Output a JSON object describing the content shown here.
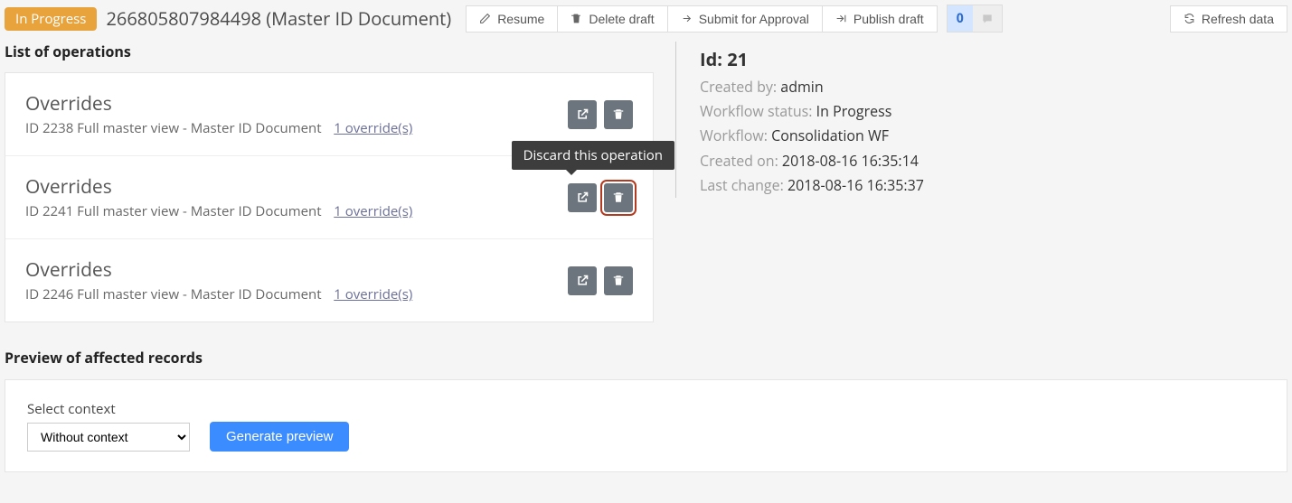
{
  "header": {
    "status_badge": "In Progress",
    "title": "266805807984498 (Master ID Document)",
    "toolbar": {
      "resume": "Resume",
      "delete_draft": "Delete draft",
      "submit_approval": "Submit for Approval",
      "publish_draft": "Publish draft",
      "refresh": "Refresh data"
    },
    "comments_count": "0"
  },
  "operations": {
    "heading": "List of operations",
    "tooltip_discard": "Discard this operation",
    "items": [
      {
        "title": "Overrides",
        "subtitle": "ID 2238 Full master view - Master ID Document",
        "link": "1 override(s)"
      },
      {
        "title": "Overrides",
        "subtitle": "ID 2241 Full master view - Master ID Document",
        "link": "1 override(s)"
      },
      {
        "title": "Overrides",
        "subtitle": "ID 2246 Full master view - Master ID Document",
        "link": "1 override(s)"
      }
    ]
  },
  "details": {
    "id_label": "Id: ",
    "id_value": "21",
    "created_by_label": "Created by: ",
    "created_by_value": "admin",
    "wf_status_label": "Workflow status: ",
    "wf_status_value": "In Progress",
    "wf_label": "Workflow: ",
    "wf_value": "Consolidation WF",
    "created_on_label": "Created on: ",
    "created_on_value": "2018-08-16 16:35:14",
    "last_change_label": "Last change: ",
    "last_change_value": "2018-08-16 16:35:37"
  },
  "preview": {
    "heading": "Preview of affected records",
    "select_label": "Select context",
    "select_value": "Without context",
    "generate_btn": "Generate preview"
  }
}
